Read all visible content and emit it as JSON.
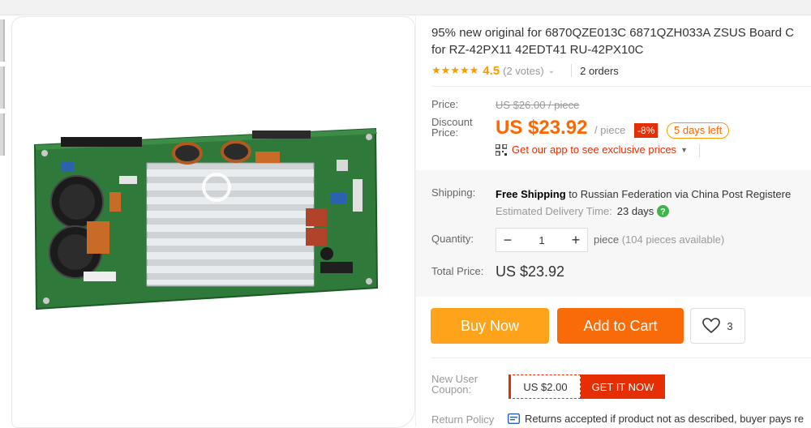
{
  "product": {
    "title_line1": "95% new original for 6870QZE013C 6871QZH033A ZSUS Board C",
    "title_line2": "for RZ-42PX11 42EDT41 RU-42PX10C",
    "rating": "4.5",
    "votes": "(2 votes)",
    "orders": "2 orders",
    "image_icon": "circuit-board-photo"
  },
  "pricing": {
    "price_label": "Price:",
    "original_price": "US $26.00 / piece",
    "discount_label_line1": "Discount",
    "discount_label_line2": "Price:",
    "discount_price": "US $23.92",
    "per_piece": "/ piece",
    "off": "-8%",
    "days_left": "5 days left",
    "app_promo": "Get our app to see exclusive prices"
  },
  "shipping": {
    "label": "Shipping:",
    "free": "Free Shipping",
    "to": "to",
    "destination": "Russian Federation via China Post Registere",
    "est_label": "Estimated Delivery Time:",
    "est_value": "23 days"
  },
  "quantity": {
    "label": "Quantity:",
    "minus": "−",
    "value": "1",
    "plus": "+",
    "piece": "piece",
    "available": "(104 pieces available)"
  },
  "total": {
    "label": "Total Price:",
    "value": "US $23.92"
  },
  "actions": {
    "buy_now": "Buy Now",
    "add_to_cart": "Add to Cart",
    "wish_count": "3"
  },
  "coupon": {
    "label_line1": "New User",
    "label_line2": "Coupon:",
    "value": "US $2.00",
    "cta": "GET IT NOW"
  },
  "returns": {
    "label": "Return Policy",
    "text": "Returns accepted if product not as described, buyer pays re"
  },
  "colors": {
    "accent_orange": "#f60",
    "buy_now": "#ffa31a",
    "add_to_cart": "#f96a08",
    "coupon_red": "#e62e04",
    "pcb_green": "#2f7a3a"
  }
}
